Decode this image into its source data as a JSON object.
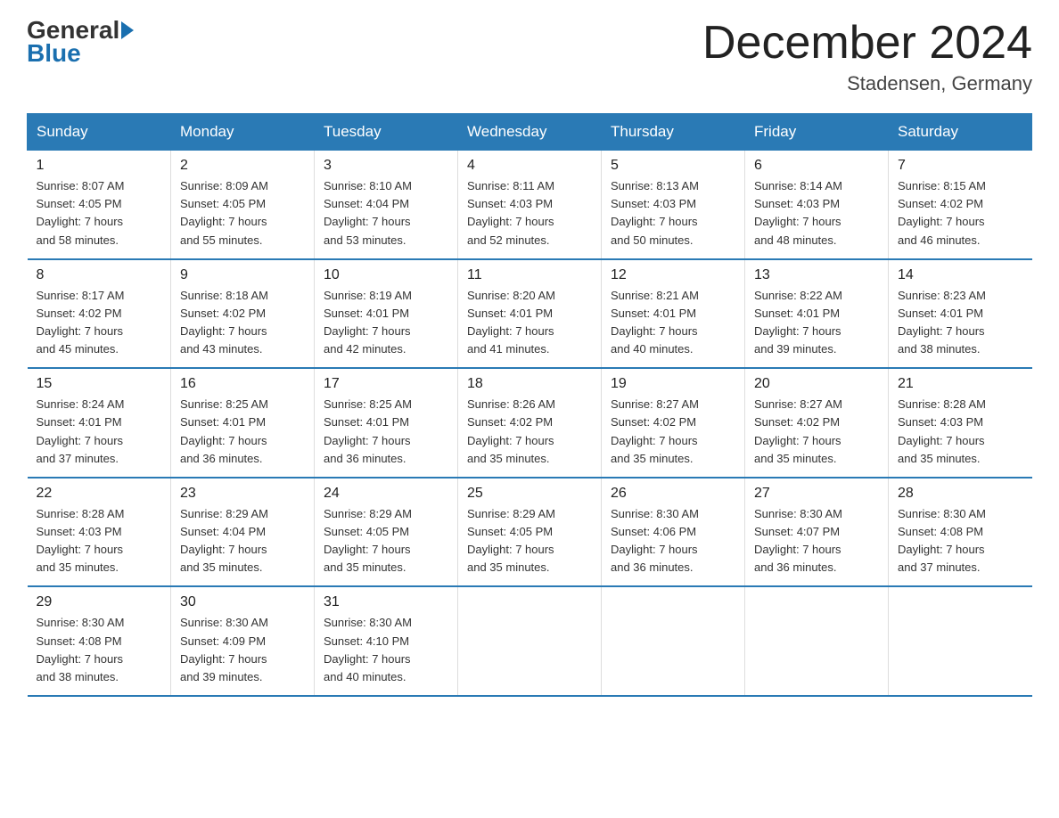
{
  "header": {
    "logo_general": "General",
    "logo_blue": "Blue",
    "month_title": "December 2024",
    "location": "Stadensen, Germany"
  },
  "weekdays": [
    "Sunday",
    "Monday",
    "Tuesday",
    "Wednesday",
    "Thursday",
    "Friday",
    "Saturday"
  ],
  "weeks": [
    [
      {
        "day": "1",
        "info": "Sunrise: 8:07 AM\nSunset: 4:05 PM\nDaylight: 7 hours\nand 58 minutes."
      },
      {
        "day": "2",
        "info": "Sunrise: 8:09 AM\nSunset: 4:05 PM\nDaylight: 7 hours\nand 55 minutes."
      },
      {
        "day": "3",
        "info": "Sunrise: 8:10 AM\nSunset: 4:04 PM\nDaylight: 7 hours\nand 53 minutes."
      },
      {
        "day": "4",
        "info": "Sunrise: 8:11 AM\nSunset: 4:03 PM\nDaylight: 7 hours\nand 52 minutes."
      },
      {
        "day": "5",
        "info": "Sunrise: 8:13 AM\nSunset: 4:03 PM\nDaylight: 7 hours\nand 50 minutes."
      },
      {
        "day": "6",
        "info": "Sunrise: 8:14 AM\nSunset: 4:03 PM\nDaylight: 7 hours\nand 48 minutes."
      },
      {
        "day": "7",
        "info": "Sunrise: 8:15 AM\nSunset: 4:02 PM\nDaylight: 7 hours\nand 46 minutes."
      }
    ],
    [
      {
        "day": "8",
        "info": "Sunrise: 8:17 AM\nSunset: 4:02 PM\nDaylight: 7 hours\nand 45 minutes."
      },
      {
        "day": "9",
        "info": "Sunrise: 8:18 AM\nSunset: 4:02 PM\nDaylight: 7 hours\nand 43 minutes."
      },
      {
        "day": "10",
        "info": "Sunrise: 8:19 AM\nSunset: 4:01 PM\nDaylight: 7 hours\nand 42 minutes."
      },
      {
        "day": "11",
        "info": "Sunrise: 8:20 AM\nSunset: 4:01 PM\nDaylight: 7 hours\nand 41 minutes."
      },
      {
        "day": "12",
        "info": "Sunrise: 8:21 AM\nSunset: 4:01 PM\nDaylight: 7 hours\nand 40 minutes."
      },
      {
        "day": "13",
        "info": "Sunrise: 8:22 AM\nSunset: 4:01 PM\nDaylight: 7 hours\nand 39 minutes."
      },
      {
        "day": "14",
        "info": "Sunrise: 8:23 AM\nSunset: 4:01 PM\nDaylight: 7 hours\nand 38 minutes."
      }
    ],
    [
      {
        "day": "15",
        "info": "Sunrise: 8:24 AM\nSunset: 4:01 PM\nDaylight: 7 hours\nand 37 minutes."
      },
      {
        "day": "16",
        "info": "Sunrise: 8:25 AM\nSunset: 4:01 PM\nDaylight: 7 hours\nand 36 minutes."
      },
      {
        "day": "17",
        "info": "Sunrise: 8:25 AM\nSunset: 4:01 PM\nDaylight: 7 hours\nand 36 minutes."
      },
      {
        "day": "18",
        "info": "Sunrise: 8:26 AM\nSunset: 4:02 PM\nDaylight: 7 hours\nand 35 minutes."
      },
      {
        "day": "19",
        "info": "Sunrise: 8:27 AM\nSunset: 4:02 PM\nDaylight: 7 hours\nand 35 minutes."
      },
      {
        "day": "20",
        "info": "Sunrise: 8:27 AM\nSunset: 4:02 PM\nDaylight: 7 hours\nand 35 minutes."
      },
      {
        "day": "21",
        "info": "Sunrise: 8:28 AM\nSunset: 4:03 PM\nDaylight: 7 hours\nand 35 minutes."
      }
    ],
    [
      {
        "day": "22",
        "info": "Sunrise: 8:28 AM\nSunset: 4:03 PM\nDaylight: 7 hours\nand 35 minutes."
      },
      {
        "day": "23",
        "info": "Sunrise: 8:29 AM\nSunset: 4:04 PM\nDaylight: 7 hours\nand 35 minutes."
      },
      {
        "day": "24",
        "info": "Sunrise: 8:29 AM\nSunset: 4:05 PM\nDaylight: 7 hours\nand 35 minutes."
      },
      {
        "day": "25",
        "info": "Sunrise: 8:29 AM\nSunset: 4:05 PM\nDaylight: 7 hours\nand 35 minutes."
      },
      {
        "day": "26",
        "info": "Sunrise: 8:30 AM\nSunset: 4:06 PM\nDaylight: 7 hours\nand 36 minutes."
      },
      {
        "day": "27",
        "info": "Sunrise: 8:30 AM\nSunset: 4:07 PM\nDaylight: 7 hours\nand 36 minutes."
      },
      {
        "day": "28",
        "info": "Sunrise: 8:30 AM\nSunset: 4:08 PM\nDaylight: 7 hours\nand 37 minutes."
      }
    ],
    [
      {
        "day": "29",
        "info": "Sunrise: 8:30 AM\nSunset: 4:08 PM\nDaylight: 7 hours\nand 38 minutes."
      },
      {
        "day": "30",
        "info": "Sunrise: 8:30 AM\nSunset: 4:09 PM\nDaylight: 7 hours\nand 39 minutes."
      },
      {
        "day": "31",
        "info": "Sunrise: 8:30 AM\nSunset: 4:10 PM\nDaylight: 7 hours\nand 40 minutes."
      },
      null,
      null,
      null,
      null
    ]
  ]
}
